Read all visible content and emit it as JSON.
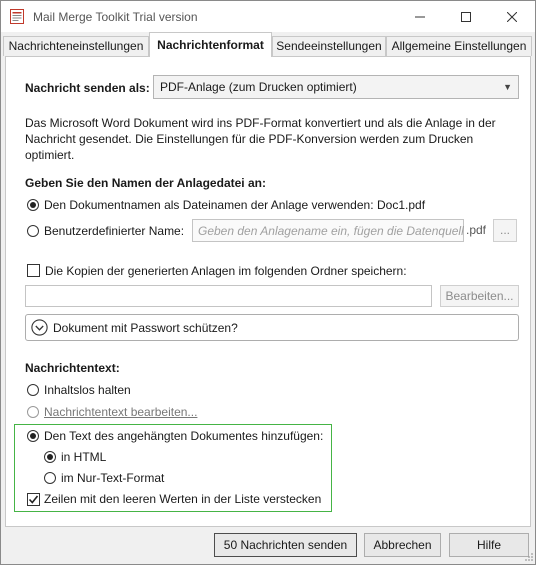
{
  "window": {
    "title": "Mail Merge Toolkit Trial version"
  },
  "tabs": [
    {
      "label": "Nachrichteneinstellungen"
    },
    {
      "label": "Nachrichtenformat"
    },
    {
      "label": "Sendeeinstellungen"
    },
    {
      "label": "Allgemeine Einstellungen"
    }
  ],
  "send_as": {
    "label": "Nachricht senden als:",
    "value": "PDF-Anlage (zum Drucken optimiert)"
  },
  "description": {
    "line1": "Das Microsoft Word Dokument wird ins PDF-Format konvertiert und als die Anlage in der",
    "line2": "Nachricht gesendet. Die Einstellungen für die PDF-Konversion werden zum Drucken",
    "line3": "optimiert."
  },
  "attachment_name": {
    "heading": "Geben Sie den Namen der Anlagedatei an:",
    "use_doc_name_label": "Den Dokumentnamen als Dateinamen der Anlage verwenden:",
    "doc_name": "Doc1.pdf",
    "custom_label": "Benutzerdefinierter Name:",
    "custom_placeholder": "Geben den Anlagename ein, fügen die Datenquellen",
    "extension": ".pdf",
    "ellipsis_button": "..."
  },
  "save_copies": {
    "label": "Die Kopien der generierten Anlagen im folgenden Ordner speichern:",
    "folder_value": "",
    "edit_button": "Bearbeiten..."
  },
  "password": {
    "label": "Dokument mit Passwort schützen?"
  },
  "message_text": {
    "heading": "Nachrichtentext:",
    "keep_empty": "Inhaltslos halten",
    "edit_text": "Nachrichtentext bearbeiten...",
    "add_doc_text": "Den Text des angehängten Dokumentes hinzufügen:",
    "in_html": "in HTML",
    "plain_text": "im Nur-Text-Format",
    "hide_empty_rows": "Zeilen mit den leeren Werten in der Liste verstecken"
  },
  "footer": {
    "send_button": "50 Nachrichten senden",
    "cancel_button": "Abbrechen",
    "help_button": "Hilfe"
  },
  "colors": {
    "highlight_border": "#45b445",
    "panel_bg": "#ffffff",
    "window_bg": "#f0f0f0"
  }
}
